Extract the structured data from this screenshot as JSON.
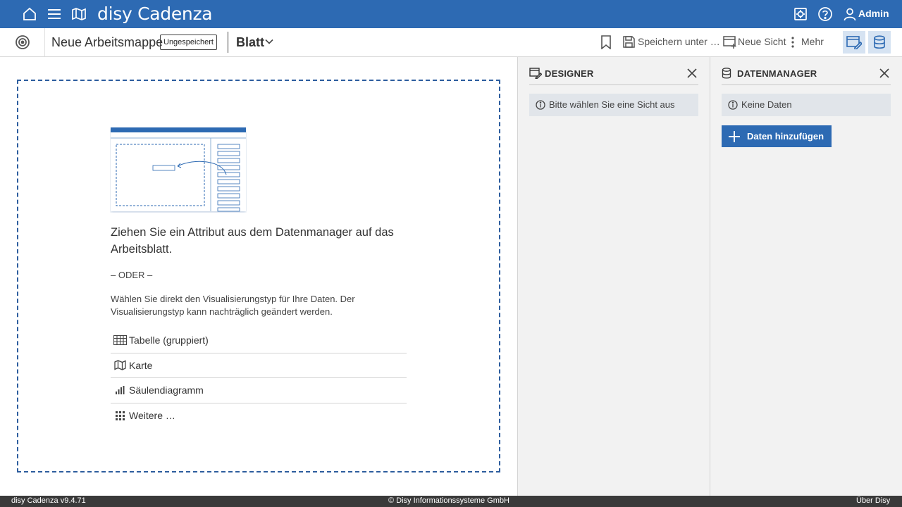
{
  "app": {
    "title": "disy Cadenza",
    "user": "Admin"
  },
  "toolbar": {
    "workbook_title": "Neue Arbeitsmappe",
    "unsaved_badge": "Ungespeichert",
    "sheet_label": "Blatt",
    "save_as_label": "Speichern unter …",
    "new_view_label": "Neue Sicht",
    "more_label": "Mehr"
  },
  "dropzone": {
    "heading": "Ziehen Sie ein Attribut aus dem Datenmanager auf das Arbeitsblatt.",
    "separator": "– ODER –",
    "description": "Wählen Sie direkt den Visualisierungstyp für Ihre Daten. Der Visualisierungstyp kann nachträglich geändert werden.",
    "options": [
      {
        "label": "Tabelle (gruppiert)",
        "icon": "table-icon"
      },
      {
        "label": "Karte",
        "icon": "map-icon"
      },
      {
        "label": "Säulendiagramm",
        "icon": "bar-chart-icon"
      },
      {
        "label": "Weitere …",
        "icon": "grid-icon"
      }
    ]
  },
  "designer": {
    "title": "DESIGNER",
    "info": "Bitte wählen Sie eine Sicht aus"
  },
  "datamanager": {
    "title": "DATENMANAGER",
    "info": "Keine Daten",
    "add_button": "Daten hinzufügen"
  },
  "footer": {
    "version": "disy Cadenza v9.4.71",
    "copyright": "© Disy Informationssysteme GmbH",
    "about": "Über Disy"
  },
  "colors": {
    "brand": "#2d6ab3",
    "footer": "#3a3a3a",
    "panel_bg": "#f2f2f2"
  }
}
